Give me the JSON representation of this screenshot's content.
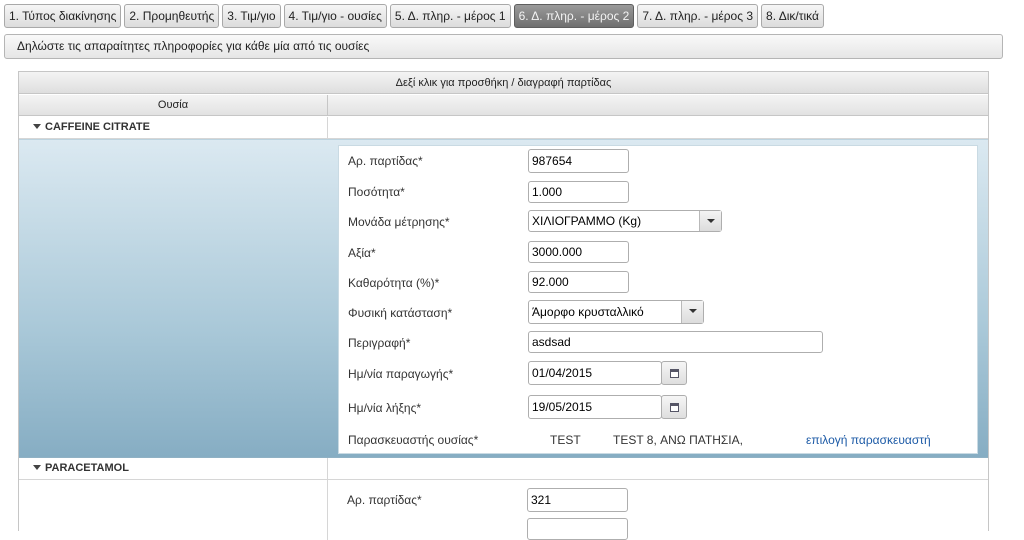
{
  "tabs": [
    {
      "label": "1. Τύπος διακίνησης",
      "active": false
    },
    {
      "label": "2. Προμηθευτής",
      "active": false
    },
    {
      "label": "3. Τιμ/γιο",
      "active": false
    },
    {
      "label": "4. Τιμ/γιο - ουσίες",
      "active": false
    },
    {
      "label": "5. Δ. πληρ. - μέρος 1",
      "active": false
    },
    {
      "label": "6. Δ. πληρ. - μέρος 2",
      "active": true
    },
    {
      "label": "7. Δ. πληρ. - μέρος 3",
      "active": false
    },
    {
      "label": "8. Δικ/τικά",
      "active": false
    }
  ],
  "instruction": "Δηλώστε τις απαραίτητες πληροφορίες για κάθε μία από τις ουσίες",
  "grid": {
    "caption": "Δεξί κλικ για προσθήκη / διαγραφή παρτίδας",
    "column_header": "Ουσία"
  },
  "groups": [
    {
      "name": "CAFFEINE CITRATE",
      "labels": {
        "batch": "Αρ. παρτίδας*",
        "quantity": "Ποσότητα*",
        "unit": "Μονάδα μέτρησης*",
        "value": "Αξία*",
        "purity": "Καθαρότητα (%)*",
        "state": "Φυσική κατάσταση*",
        "description": "Περιγραφή*",
        "prod_date": "Ημ/νία παραγωγής*",
        "exp_date": "Ημ/νία λήξης*",
        "manufacturer": "Παρασκευαστής ουσίας*"
      },
      "values": {
        "batch": "987654",
        "quantity": "1.000",
        "unit": "ΧΙΛΙΟΓΡΑΜΜΟ (Kg)",
        "value": "3000.000",
        "purity": "92.000",
        "state": "Άμορφο κρυσταλλικό",
        "description": "asdsad",
        "prod_date": "01/04/2015",
        "exp_date": "19/05/2015",
        "manufacturer_name": "TEST",
        "manufacturer_address": "TEST 8, ΑΝΩ ΠΑΤΗΣΙΑ,",
        "manufacturer_link": "επιλογή παρασκευαστή"
      }
    },
    {
      "name": "PARACETAMOL",
      "labels": {
        "batch": "Αρ. παρτίδας*"
      },
      "values": {
        "batch": "321"
      }
    }
  ],
  "icons": {
    "expand": "caret-down-icon",
    "calendar": "calendar-icon",
    "dropdown": "chevron-down-icon"
  }
}
